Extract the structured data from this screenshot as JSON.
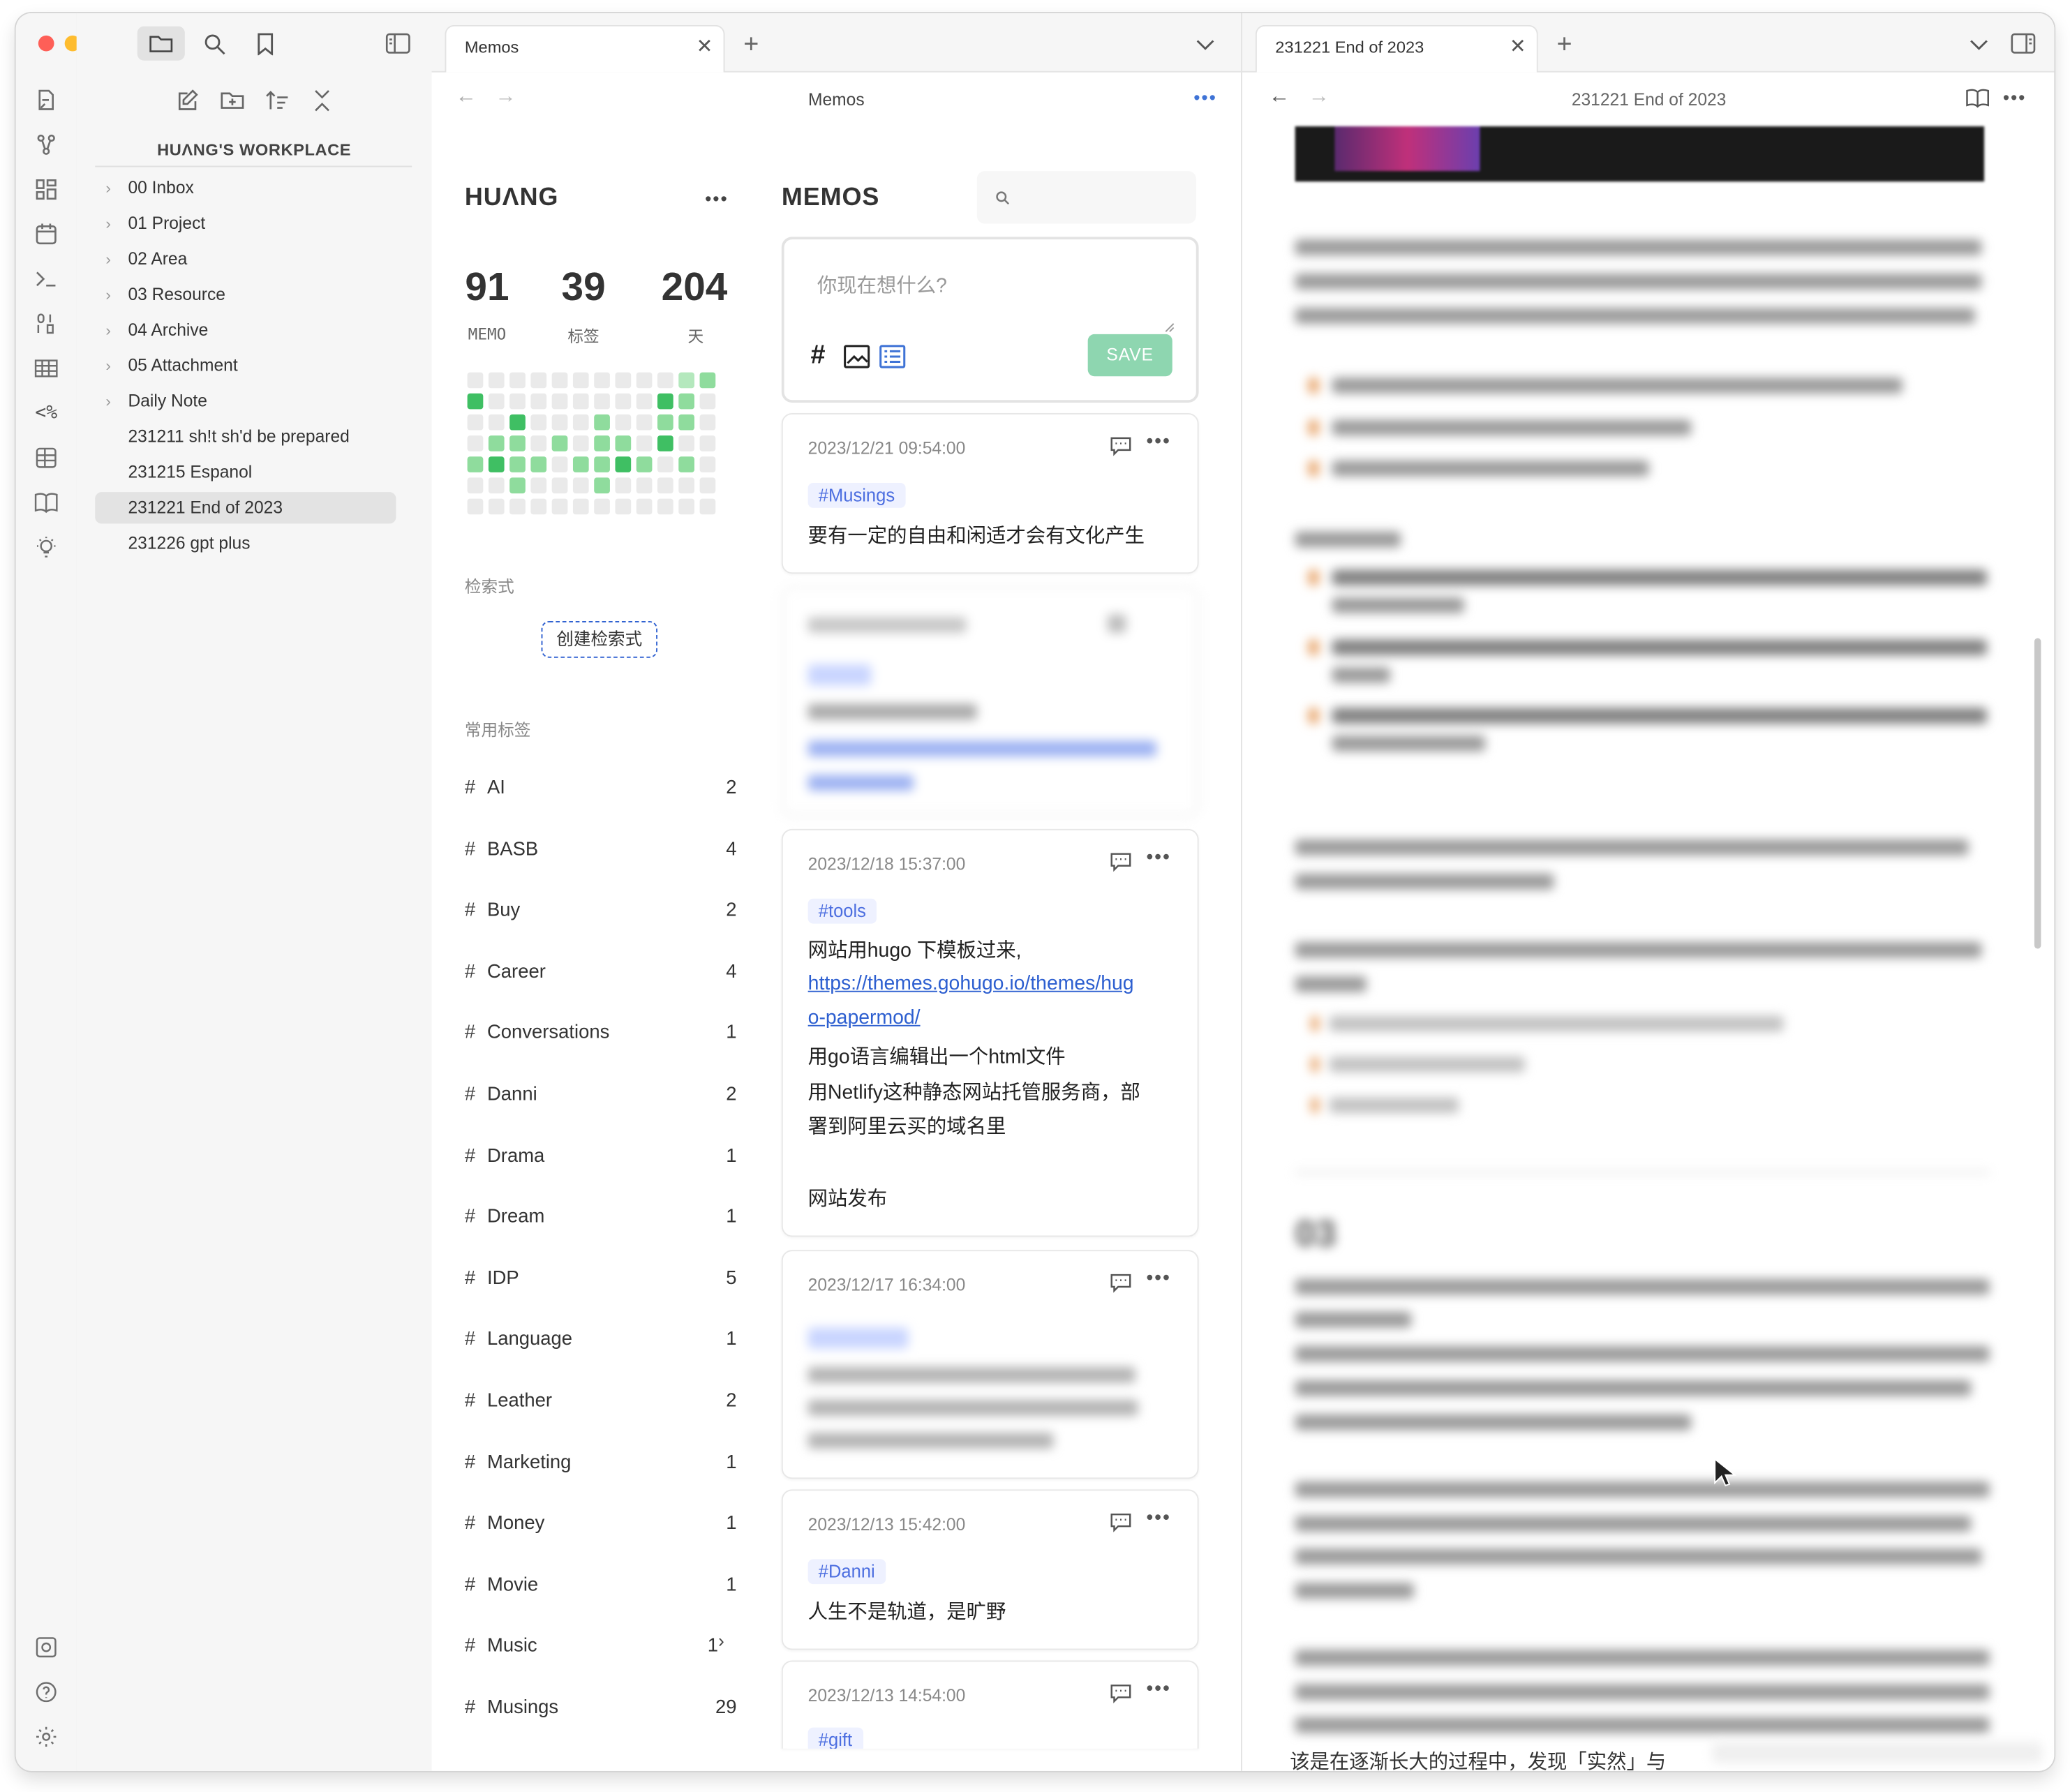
{
  "window_title_tabs": {
    "left_tab": "Memos",
    "right_tab": "231221 End of 2023"
  },
  "sidebar": {
    "vault_name": "HUΛNG'S WORKPLACE",
    "items": [
      {
        "label": "00 Inbox",
        "folder": true
      },
      {
        "label": "01 Project",
        "folder": true
      },
      {
        "label": "02 Area",
        "folder": true
      },
      {
        "label": "03 Resource",
        "folder": true
      },
      {
        "label": "04 Archive",
        "folder": true
      },
      {
        "label": "05 Attachment",
        "folder": true
      },
      {
        "label": "Daily Note",
        "folder": true
      },
      {
        "label": "231211 sh!t sh'd be prepared",
        "folder": false
      },
      {
        "label": "231215 Espanol",
        "folder": false
      },
      {
        "label": "231221 End of 2023",
        "folder": false,
        "active": true
      },
      {
        "label": "231226 gpt plus",
        "folder": false
      }
    ]
  },
  "memos_pane": {
    "nav_title": "Memos",
    "profile": {
      "name": "HUΛNG",
      "stats": [
        {
          "value": "91",
          "label": "MEMO"
        },
        {
          "value": "39",
          "label": "标签"
        },
        {
          "value": "204",
          "label": "天"
        }
      ]
    },
    "query_section_title": "检索式",
    "create_query_label": "创建检索式",
    "common_tags_title": "常用标签",
    "tags": [
      {
        "name": "AI",
        "count": "2"
      },
      {
        "name": "BASB",
        "count": "4"
      },
      {
        "name": "Buy",
        "count": "2"
      },
      {
        "name": "Career",
        "count": "4"
      },
      {
        "name": "Conversations",
        "count": "1"
      },
      {
        "name": "Danni",
        "count": "2"
      },
      {
        "name": "Drama",
        "count": "1"
      },
      {
        "name": "Dream",
        "count": "1"
      },
      {
        "name": "IDP",
        "count": "5"
      },
      {
        "name": "Language",
        "count": "1"
      },
      {
        "name": "Leather",
        "count": "2"
      },
      {
        "name": "Marketing",
        "count": "1"
      },
      {
        "name": "Money",
        "count": "1"
      },
      {
        "name": "Movie",
        "count": "1"
      },
      {
        "name": "Music",
        "count": "1"
      },
      {
        "name": "Musings",
        "count": "29"
      }
    ],
    "memos_title": "MEMOS",
    "editor_placeholder": "你现在想什么?",
    "save_label": "SAVE",
    "memos": [
      {
        "timestamp": "2023/12/21 09:54:00",
        "tag": "#Musings",
        "lines": [
          "要有一定的自由和闲适才会有文化产生"
        ]
      },
      {
        "timestamp": "2023/12/18 15:37:00",
        "tag": "#tools",
        "lines": [
          "网站用hugo 下模板过来,"
        ],
        "link": "https://themes.gohugo.io/themes/hugo-papermod/",
        "link_line1": "https://themes.gohugo.io/themes/hug",
        "link_line2": "o-papermod/",
        "after": [
          "用go语言编辑出一个html文件",
          "用Netlify这种静态网站托管服务商，部",
          "署到阿里云买的域名里",
          "",
          "网站发布"
        ]
      },
      {
        "timestamp": "2023/12/17 16:34:00"
      },
      {
        "timestamp": "2023/12/13 15:42:00",
        "tag": "#Danni",
        "lines": [
          "人生不是轨道，是旷野"
        ]
      },
      {
        "timestamp": "2023/12/13 14:54:00",
        "tag": "#gift"
      }
    ]
  },
  "note_pane": {
    "nav_title": "231221 End of 2023",
    "heading_03": "03",
    "bottom_line": "该是在逐渐长大的过程中，发现「实然」与"
  },
  "colors": {
    "accent_green": "#3fbf63",
    "save_button": "#8ed6b0",
    "tag_blue": "#4c6ee0"
  }
}
